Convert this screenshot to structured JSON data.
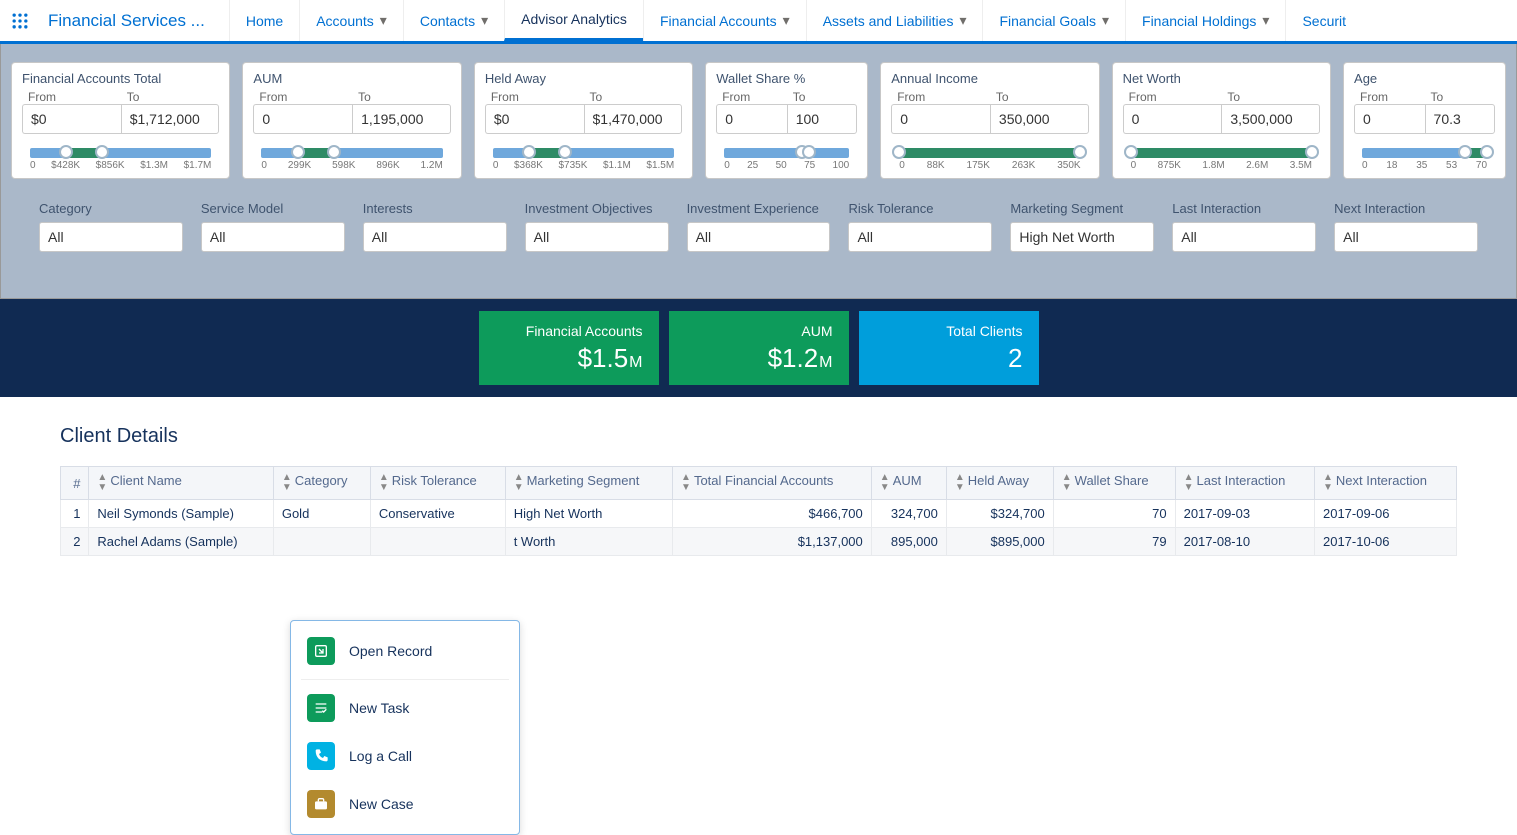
{
  "app_name": "Financial Services ...",
  "nav": [
    {
      "label": "Home",
      "dropdown": false
    },
    {
      "label": "Accounts",
      "dropdown": true
    },
    {
      "label": "Contacts",
      "dropdown": true
    },
    {
      "label": "Advisor Analytics",
      "dropdown": false,
      "active": true
    },
    {
      "label": "Financial Accounts",
      "dropdown": true
    },
    {
      "label": "Assets and Liabilities",
      "dropdown": true
    },
    {
      "label": "Financial Goals",
      "dropdown": true
    },
    {
      "label": "Financial Holdings",
      "dropdown": true
    },
    {
      "label": "Securit",
      "dropdown": false
    }
  ],
  "ranges": [
    {
      "title": "Financial Accounts Total",
      "from": "$0",
      "to": "$1,712,000",
      "ticks": [
        "0",
        "$428K",
        "$856K",
        "$1.3M",
        "$1.7M"
      ],
      "fill": [
        20,
        40
      ]
    },
    {
      "title": "AUM",
      "from": "0",
      "to": "1,195,000",
      "ticks": [
        "0",
        "299K",
        "598K",
        "896K",
        "1.2M"
      ],
      "fill": [
        20,
        40
      ]
    },
    {
      "title": "Held Away",
      "from": "$0",
      "to": "$1,470,000",
      "ticks": [
        "0",
        "$368K",
        "$735K",
        "$1.1M",
        "$1.5M"
      ],
      "fill": [
        20,
        40
      ]
    },
    {
      "title": "Wallet Share %",
      "from": "0",
      "to": "100",
      "ticks": [
        "0",
        "25",
        "50",
        "75",
        "100"
      ],
      "fill": [
        62,
        68
      ],
      "narrow": true
    },
    {
      "title": "Annual Income",
      "from": "0",
      "to": "350,000",
      "ticks": [
        "0",
        "88K",
        "175K",
        "263K",
        "350K"
      ],
      "fill": [
        0,
        100
      ]
    },
    {
      "title": "Net Worth",
      "from": "0",
      "to": "3,500,000",
      "ticks": [
        "0",
        "875K",
        "1.8M",
        "2.6M",
        "3.5M"
      ],
      "fill": [
        0,
        100
      ]
    },
    {
      "title": "Age",
      "from": "0",
      "to": "70.3",
      "ticks": [
        "0",
        "18",
        "35",
        "53",
        "70"
      ],
      "fill": [
        82,
        100
      ],
      "narrow": true
    }
  ],
  "dropdowns": [
    {
      "label": "Category",
      "value": "All"
    },
    {
      "label": "Service Model",
      "value": "All"
    },
    {
      "label": "Interests",
      "value": "All"
    },
    {
      "label": "Investment Objectives",
      "value": "All"
    },
    {
      "label": "Investment Experience",
      "value": "All"
    },
    {
      "label": "Risk Tolerance",
      "value": "All"
    },
    {
      "label": "Marketing Segment",
      "value": "High Net Worth"
    },
    {
      "label": "Last Interaction",
      "value": "All"
    },
    {
      "label": "Next Interaction",
      "value": "All"
    }
  ],
  "kpis": [
    {
      "label": "Financial Accounts",
      "value": "$1.5",
      "unit": "M",
      "color": "green"
    },
    {
      "label": "AUM",
      "value": "$1.2",
      "unit": "M",
      "color": "green"
    },
    {
      "label": "Total Clients",
      "value": "2",
      "unit": "",
      "color": "blue"
    }
  ],
  "details": {
    "title": "Client Details",
    "columns": [
      "#",
      "Client Name",
      "Category",
      "Risk Tolerance",
      "Marketing Segment",
      "Total Financial Accounts",
      "AUM",
      "Held Away",
      "Wallet Share",
      "Last Interaction",
      "Next Interaction"
    ],
    "rows": [
      {
        "num": "1",
        "name": "Neil Symonds (Sample)",
        "category": "Gold",
        "risk": "Conservative",
        "seg": "High Net Worth",
        "tfa": "$466,700",
        "aum": "324,700",
        "held": "$324,700",
        "ws": "70",
        "li": "2017-09-03",
        "ni": "2017-09-06"
      },
      {
        "num": "2",
        "name": "Rachel Adams (Sample)",
        "category": "",
        "risk": "",
        "seg": "t Worth",
        "tfa": "$1,137,000",
        "aum": "895,000",
        "held": "$895,000",
        "ws": "79",
        "li": "2017-08-10",
        "ni": "2017-10-06"
      }
    ]
  },
  "ctx": [
    {
      "label": "Open Record",
      "icon": "open",
      "color": "#0d9b5b"
    },
    {
      "label": "New Task",
      "icon": "task",
      "color": "#0d9b5b"
    },
    {
      "label": "Log a Call",
      "icon": "call",
      "color": "#00b2e3"
    },
    {
      "label": "New Case",
      "icon": "case",
      "color": "#b38a2e"
    }
  ],
  "range_labels": {
    "from": "From",
    "to": "To"
  }
}
